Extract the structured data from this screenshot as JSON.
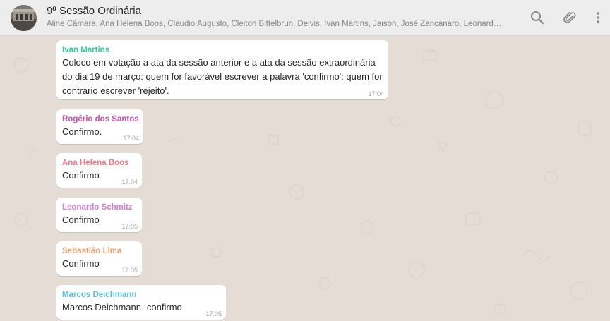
{
  "header": {
    "title": "9ª Sessão Ordinária",
    "members": "Aline Câmara, Ana Helena Boos, Claudio Augusto, Cleiton Bittelbrun, Deivis, Ivan Martins, Jaison, José Zancanaro, Leonard…",
    "icons": [
      "search-icon",
      "attach-icon",
      "menu-icon"
    ]
  },
  "messages": [
    {
      "sender": "Ivan Martins",
      "color": "#35cd96",
      "text": "Coloco em votação a ata da sessão anterior e a ata da sessão extraordinária do dia 19 de março: quem for favorável escrever a palavra 'confirmo': quem for contrario escrever 'rejeito'.",
      "time": "17:04"
    },
    {
      "sender": "Rogério dos Santos",
      "color": "#c94fae",
      "text": "Confirmo.",
      "time": "17:04"
    },
    {
      "sender": "Ana Helena Boos",
      "color": "#f2798c",
      "text": "Confirmo",
      "time": "17:04"
    },
    {
      "sender": "Leonardo Schmitz",
      "color": "#d67ad9",
      "text": "Confirmo",
      "time": "17:05"
    },
    {
      "sender": "Sebastião Lima",
      "color": "#f0a070",
      "text": "Confirmo",
      "time": "17:05"
    },
    {
      "sender": "Marcos Deichmann",
      "color": "#5bbfdc",
      "text": "Marcos Deichmann- confirmo",
      "time": "17:05"
    }
  ]
}
